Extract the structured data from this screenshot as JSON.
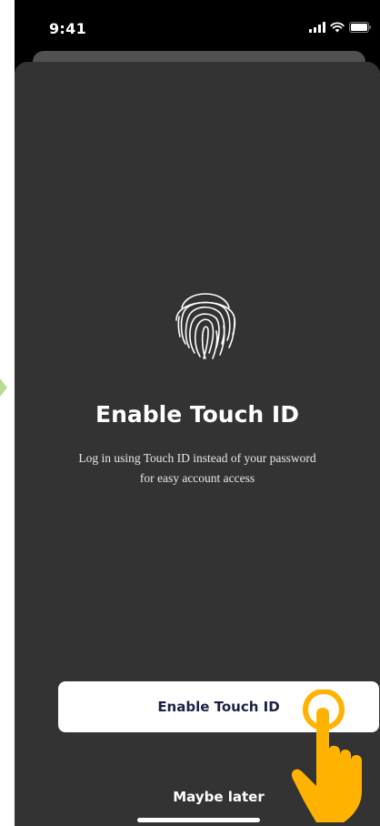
{
  "status_bar": {
    "time": "9:41",
    "icons": [
      "cellular-signal-icon",
      "wifi-icon",
      "battery-icon"
    ]
  },
  "modal": {
    "icon": "fingerprint-icon",
    "title": "Enable Touch ID",
    "subtitle_line1": "Log in using Touch ID instead of your password",
    "subtitle_line2": "for easy account access",
    "primary_button": "Enable Touch ID",
    "secondary_button": "Maybe later"
  },
  "overlay": {
    "tap_indicator": "tap-hand-icon",
    "tap_color": "#FFB300"
  },
  "colors": {
    "sheet_background": "#333333",
    "primary_button_background": "#FFFFFF",
    "primary_button_text": "#1B2146",
    "side_arrow": "#B8DC8E"
  }
}
